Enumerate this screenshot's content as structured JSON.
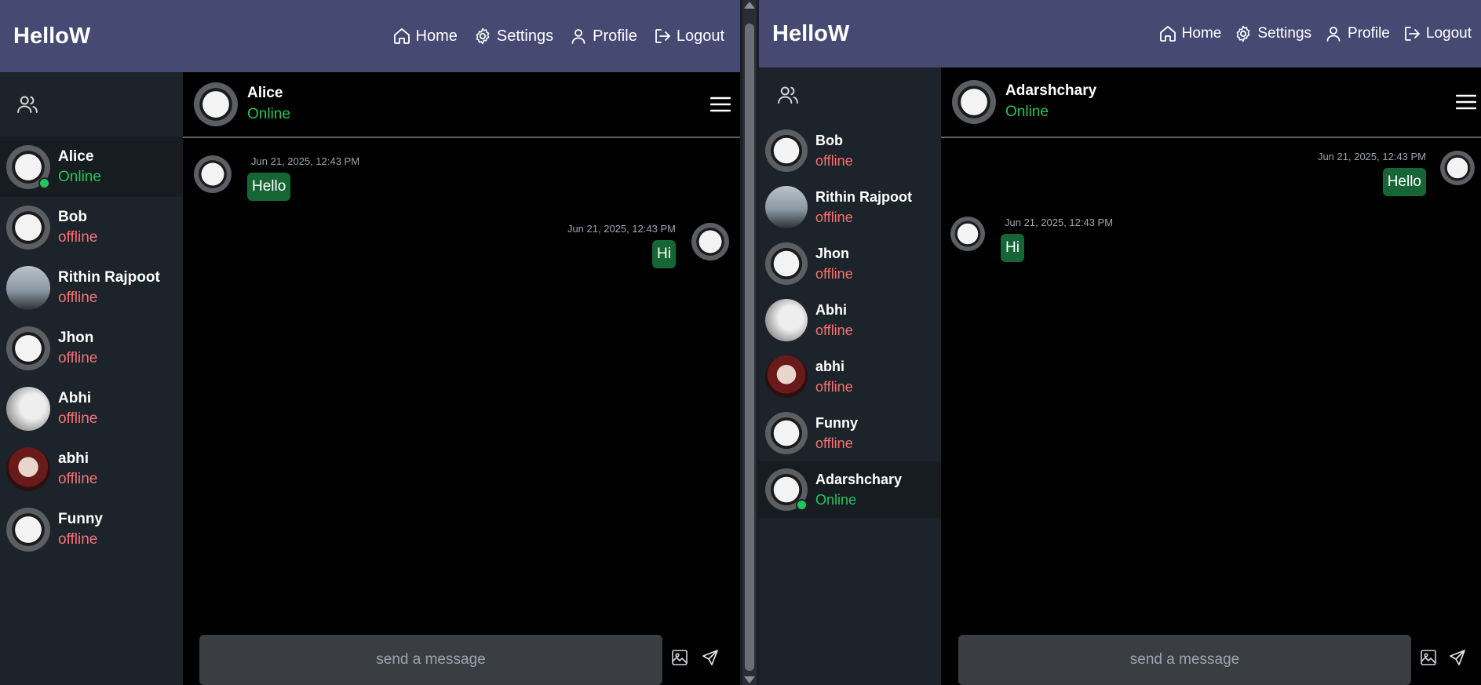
{
  "colors": {
    "navbar": "#464a73",
    "sidebar": "#1d232a",
    "bubble": "#166534",
    "online": "#22c55e",
    "offline": "#f87171"
  },
  "left": {
    "brand": "HelloW",
    "nav": [
      {
        "label": "Home",
        "icon": "home-icon"
      },
      {
        "label": "Settings",
        "icon": "gear-icon"
      },
      {
        "label": "Profile",
        "icon": "user-icon"
      },
      {
        "label": "Logout",
        "icon": "logout-icon"
      }
    ],
    "contacts": [
      {
        "name": "Alice",
        "status": "Online"
      },
      {
        "name": "Bob",
        "status": "offline"
      },
      {
        "name": "Rithin Rajpoot",
        "status": "offline"
      },
      {
        "name": "Jhon",
        "status": "offline"
      },
      {
        "name": "Abhi",
        "status": "offline"
      },
      {
        "name": "abhi",
        "status": "offline"
      },
      {
        "name": "Funny",
        "status": "offline"
      }
    ],
    "chat": {
      "name": "Alice",
      "status": "Online"
    },
    "messages": [
      {
        "time": "Jun 21, 2025, 12:43 PM",
        "text": "Hello",
        "side": "left"
      },
      {
        "time": "Jun 21, 2025, 12:43 PM",
        "text": "Hi",
        "side": "right"
      }
    ],
    "placeholder": "send a message"
  },
  "right": {
    "brand": "HelloW",
    "nav": [
      {
        "label": "Home",
        "icon": "home-icon"
      },
      {
        "label": "Settings",
        "icon": "gear-icon"
      },
      {
        "label": "Profile",
        "icon": "user-icon"
      },
      {
        "label": "Logout",
        "icon": "logout-icon"
      }
    ],
    "contacts": [
      {
        "name": "Bob",
        "status": "offline"
      },
      {
        "name": "Rithin Rajpoot",
        "status": "offline"
      },
      {
        "name": "Jhon",
        "status": "offline"
      },
      {
        "name": "Abhi",
        "status": "offline"
      },
      {
        "name": "abhi",
        "status": "offline"
      },
      {
        "name": "Funny",
        "status": "offline"
      },
      {
        "name": "Adarshchary",
        "status": "Online"
      }
    ],
    "chat": {
      "name": "Adarshchary",
      "status": "Online"
    },
    "messages": [
      {
        "time": "Jun 21, 2025, 12:43 PM",
        "text": "Hello",
        "side": "right"
      },
      {
        "time": "Jun 21, 2025, 12:43 PM",
        "text": "Hi",
        "side": "left"
      }
    ],
    "placeholder": "send a message"
  }
}
